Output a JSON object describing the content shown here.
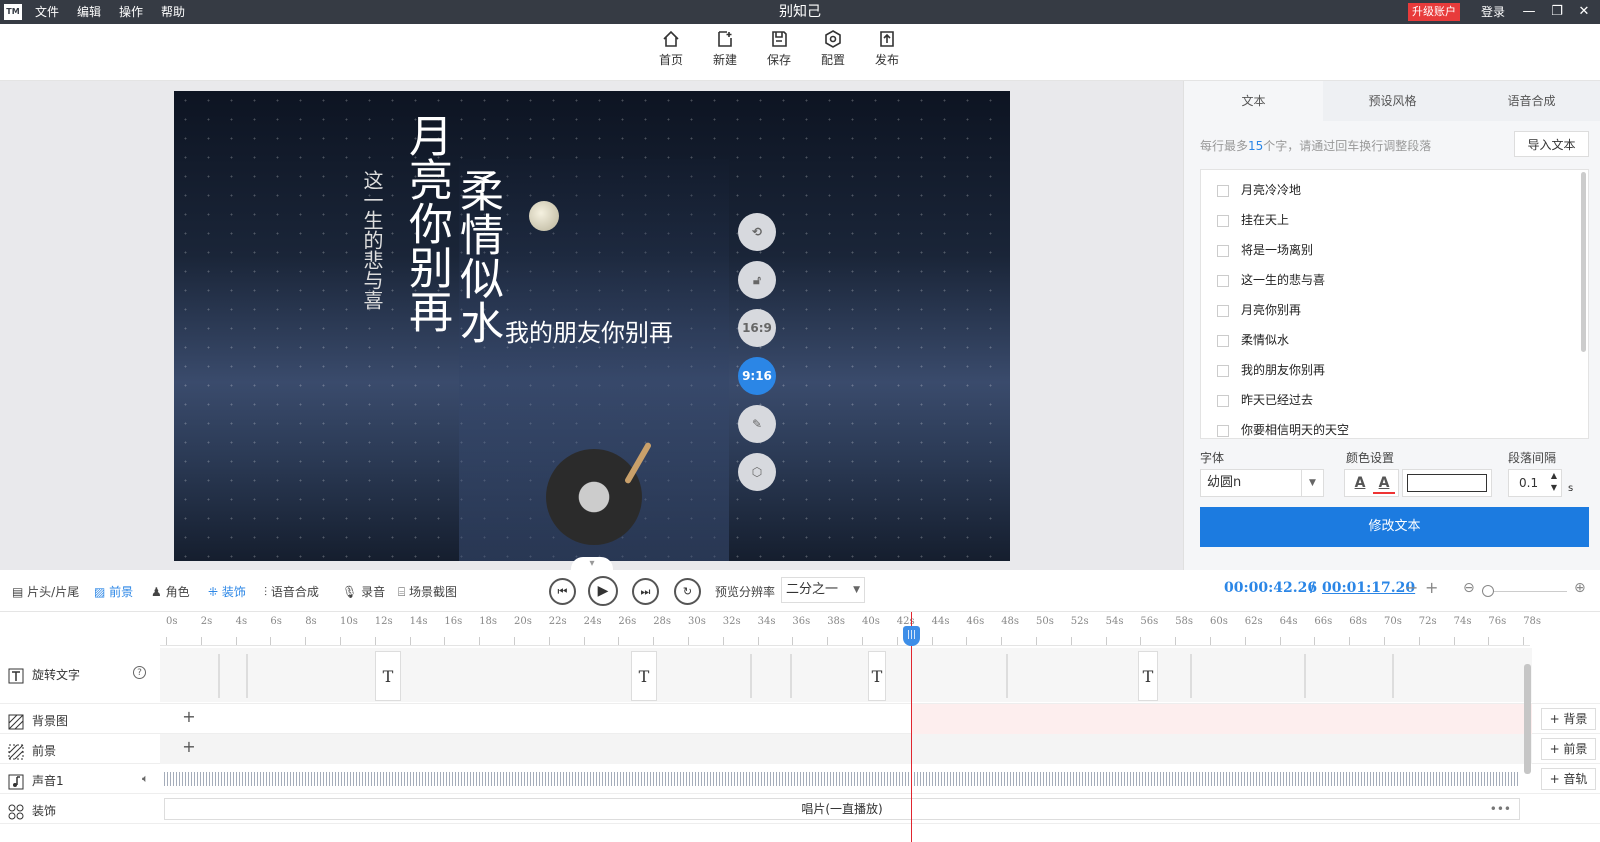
{
  "titlebar": {
    "logo": "TM",
    "menus": [
      "文件",
      "编辑",
      "操作",
      "帮助"
    ],
    "title": "别知己",
    "upgrade": "升级账户",
    "login": "登录",
    "controls": [
      "minimize-icon",
      "restore-icon",
      "close-icon"
    ]
  },
  "toolbar": {
    "items": [
      {
        "label": "首页",
        "icon": "home-icon"
      },
      {
        "label": "新建",
        "icon": "new-icon"
      },
      {
        "label": "保存",
        "icon": "save-icon"
      },
      {
        "label": "配置",
        "icon": "gear-icon"
      },
      {
        "label": "发布",
        "icon": "publish-icon"
      }
    ]
  },
  "preview": {
    "texts": {
      "line1": "这一生的悲与喜",
      "line2": "月亮你别再",
      "line3": "柔情似水",
      "line4": "我的朋友你别再"
    },
    "side_buttons": {
      "ratio1": "16:9",
      "ratio2": "9:16"
    }
  },
  "right_panel": {
    "tabs": [
      "文本",
      "预设风格",
      "语音合成"
    ],
    "hint_pre": "每行最多",
    "hint_num": "15",
    "hint_post": "个字，请通过回车换行调整段落",
    "import_btn": "导入文本",
    "lines": [
      "月亮冷冷地",
      "挂在天上",
      "将是一场离别",
      "这一生的悲与喜",
      "月亮你别再",
      "柔情似水",
      "我的朋友你别再",
      "昨天已经过去",
      "你要相信明天的天空"
    ],
    "font_label": "字体",
    "font_value": "幼圆n",
    "color_label": "颜色设置",
    "spacing_label": "段落间隔",
    "spacing_value": "0.1",
    "spacing_unit": "s",
    "modify_btn": "修改文本"
  },
  "controls": {
    "tabs": [
      "片头/片尾",
      "前景",
      "角色",
      "装饰",
      "语音合成",
      "录音",
      "场景截图"
    ],
    "res_label": "预览分辨率",
    "res_value": "二分之一",
    "time_current": "00:00:42.26",
    "time_sep": "/",
    "time_total": "00:01:17.20"
  },
  "ruler": {
    "ticks": [
      "0s",
      "2s",
      "4s",
      "6s",
      "8s",
      "10s",
      "12s",
      "14s",
      "16s",
      "18s",
      "20s",
      "22s",
      "24s",
      "26s",
      "28s",
      "30s",
      "32s",
      "34s",
      "36s",
      "38s",
      "40s",
      "42s",
      "44s",
      "46s",
      "48s",
      "50s",
      "52s",
      "54s",
      "56s",
      "58s",
      "60s",
      "62s",
      "64s",
      "66s",
      "68s",
      "70s",
      "72s",
      "74s",
      "76s",
      "78s"
    ]
  },
  "tracks": {
    "rotate_text": "旋转文字",
    "bg": "背景图",
    "fg": "前景",
    "audio": "声音1",
    "deco": "装饰",
    "deco_clip": "唱片(一直播放)",
    "add_bg": "+ 背景",
    "add_fg": "+ 前景",
    "add_audio": "+ 音轨"
  }
}
